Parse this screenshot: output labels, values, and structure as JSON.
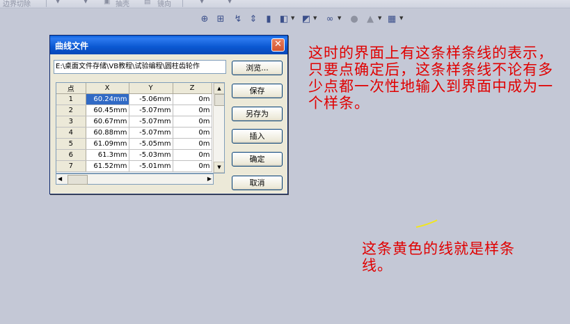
{
  "toolbar": {
    "items": [
      {
        "label": "边界切除"
      },
      {
        "label": "抽壳"
      },
      {
        "label": "镜向"
      }
    ]
  },
  "view_toolbar": {
    "icons": [
      "zoom-to-fit-icon",
      "zoom-area-icon",
      "previous-view-icon",
      "section-view-icon",
      "view-orientation-icon",
      "display-style-icon",
      "hide-show-icon",
      "edit-appearance-icon",
      "scene-icon",
      "render-icon",
      "view-settings-icon"
    ]
  },
  "dialog": {
    "title": "曲线文件",
    "close_glyph": "✕",
    "file_path": "E:\\桌面文件存储\\VB教程\\试验编程\\圆柱齿轮作",
    "buttons": {
      "browse": "浏览...",
      "save": "保存",
      "save_as": "另存为",
      "insert": "插入",
      "ok": "确定",
      "cancel": "取消"
    },
    "table": {
      "headers": [
        "点",
        "X",
        "Y",
        "Z"
      ],
      "rows": [
        {
          "point": "1",
          "x": "60.24mm",
          "y": "-5.06mm",
          "z": "0m"
        },
        {
          "point": "2",
          "x": "60.45mm",
          "y": "-5.07mm",
          "z": "0m"
        },
        {
          "point": "3",
          "x": "60.67mm",
          "y": "-5.07mm",
          "z": "0m"
        },
        {
          "point": "4",
          "x": "60.88mm",
          "y": "-5.07mm",
          "z": "0m"
        },
        {
          "point": "5",
          "x": "61.09mm",
          "y": "-5.05mm",
          "z": "0m"
        },
        {
          "point": "6",
          "x": "61.3mm",
          "y": "-5.03mm",
          "z": "0m"
        },
        {
          "point": "7",
          "x": "61.52mm",
          "y": "-5.01mm",
          "z": "0m"
        }
      ]
    }
  },
  "annotations": {
    "note1": "这时的界面上有这条样条线的表示，只要点确定后，这条样条线不论有多少点都一次性地输入到界面中成为一个样条。",
    "note2": "这条黄色的线就是样条线。"
  },
  "colors": {
    "background": "#c4c8d6",
    "annotation": "#e00000",
    "spline": "#f2e61a",
    "title_bar": "#0b58d2",
    "selection": "#316ac5"
  }
}
